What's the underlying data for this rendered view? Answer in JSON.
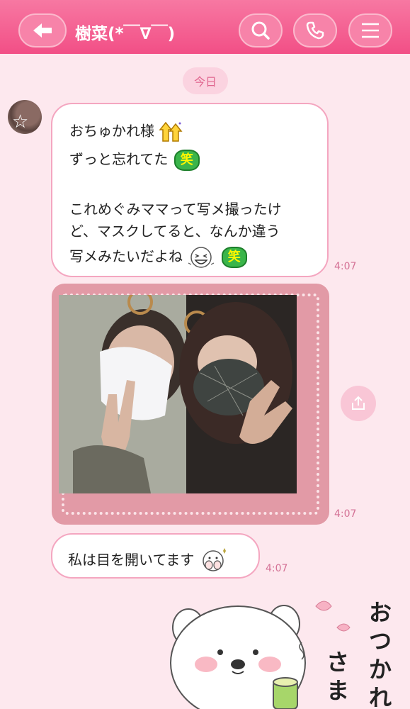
{
  "header": {
    "title": "樹菜(*￣∇￣)",
    "back_icon": "back-arrow-icon",
    "search_icon": "search-icon",
    "call_icon": "phone-icon",
    "menu_icon": "menu-icon",
    "bg_color": "#f24f86"
  },
  "chat": {
    "date_label": "今日",
    "messages": [
      {
        "lines": [
          "おちゅかれ様",
          "ずっと忘れてた",
          "",
          "これめぐみママって写メ撮ったけ",
          "ど、マスクしてると、なんか違う",
          "写メみたいだよね"
        ],
        "emoji_laugh": "笑",
        "time": "4:07"
      },
      {
        "type": "photo",
        "time": "4:07"
      },
      {
        "text": "私は目を開いてます",
        "time": "4:07"
      }
    ],
    "sticker_text": [
      "おつかれ",
      "さま"
    ]
  }
}
